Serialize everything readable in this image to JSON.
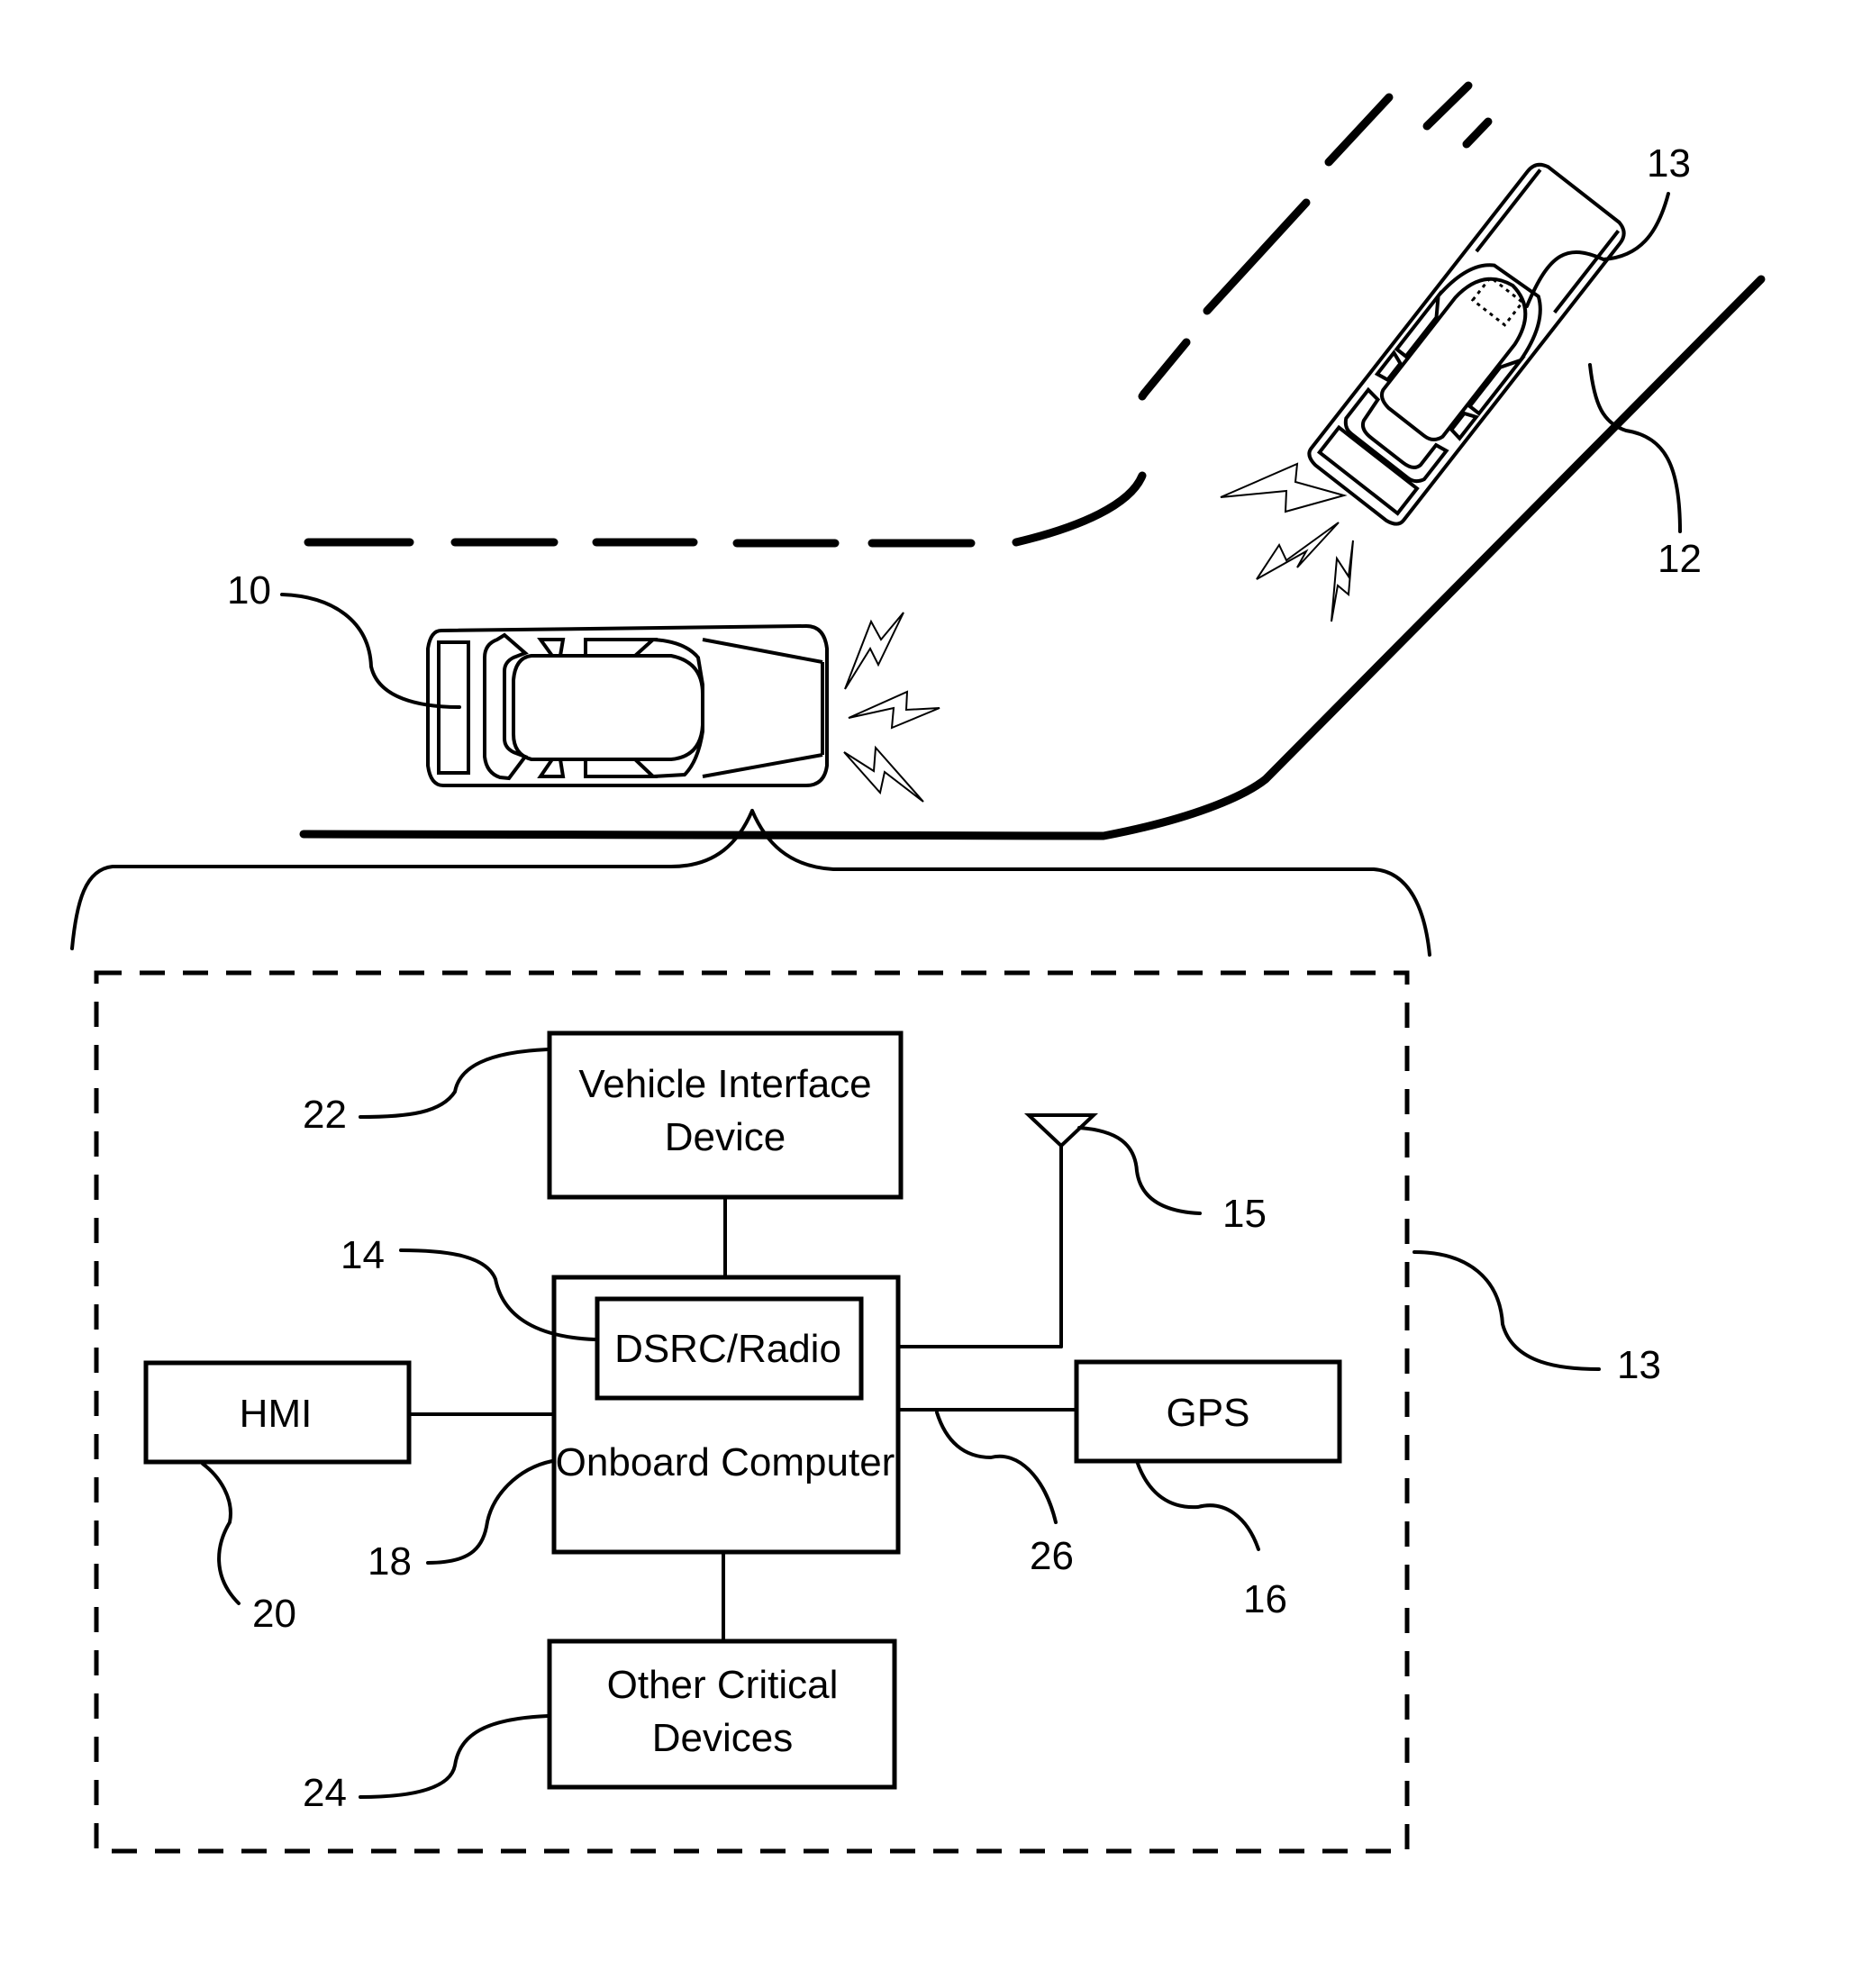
{
  "figure": {
    "type": "patent-drawing",
    "description": "Vehicle-to-vehicle communication scene with onboard system block diagram"
  },
  "scene": {
    "host_vehicle": {
      "ref": "10"
    },
    "remote_vehicle": {
      "ref": "12"
    },
    "remote_vehicle_system": {
      "ref": "13"
    },
    "wireless_signals": [
      "signal-from-host",
      "signal-from-remote"
    ]
  },
  "system": {
    "ref": "13",
    "blocks": {
      "vehicle_interface_device": {
        "ref": "22",
        "lines": [
          "Vehicle Interface",
          "Device"
        ]
      },
      "dsrc_radio": {
        "ref": "14",
        "lines": [
          "DSRC/Radio"
        ]
      },
      "onboard_computer": {
        "ref": "18",
        "lines": [
          "Onboard Computer"
        ]
      },
      "hmi": {
        "ref": "20",
        "lines": [
          "HMI"
        ]
      },
      "gps": {
        "ref": "16",
        "lines": [
          "GPS"
        ]
      },
      "other_critical_devices": {
        "ref": "24",
        "lines": [
          "Other Critical",
          "Devices"
        ]
      }
    },
    "antenna": {
      "ref": "15"
    },
    "bus": {
      "ref": "26"
    }
  }
}
